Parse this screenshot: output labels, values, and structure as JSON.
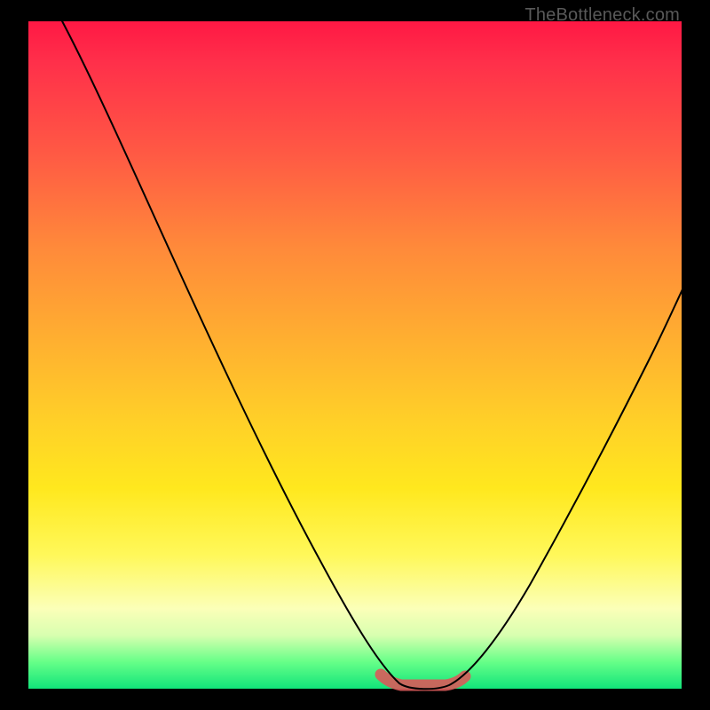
{
  "watermark": "TheBottleneck.com",
  "colors": {
    "frame": "#000000",
    "curve": "#000000",
    "highlight": "#d95a5a",
    "gradient_stops": [
      "#ff1844",
      "#ff5a44",
      "#ffb030",
      "#ffe81e",
      "#fbffb8",
      "#11e47a"
    ]
  },
  "chart_data": {
    "type": "line",
    "title": "",
    "xlabel": "",
    "ylabel": "",
    "xlim": [
      0,
      100
    ],
    "ylim": [
      0,
      100
    ],
    "series": [
      {
        "name": "bottleneck-curve",
        "x": [
          0,
          5,
          10,
          15,
          20,
          25,
          30,
          35,
          40,
          45,
          50,
          55,
          57,
          60,
          63,
          65,
          70,
          75,
          80,
          85,
          90,
          95,
          100
        ],
        "values": [
          100,
          94,
          87,
          79,
          71,
          62,
          53,
          44,
          34,
          24,
          14,
          5,
          1,
          0,
          0,
          1,
          5,
          12,
          20,
          29,
          39,
          50,
          62
        ]
      }
    ],
    "annotations": [
      {
        "name": "flat-bottom-highlight",
        "x_range": [
          54,
          66
        ],
        "y": 0,
        "color": "#d95a5a"
      }
    ]
  }
}
